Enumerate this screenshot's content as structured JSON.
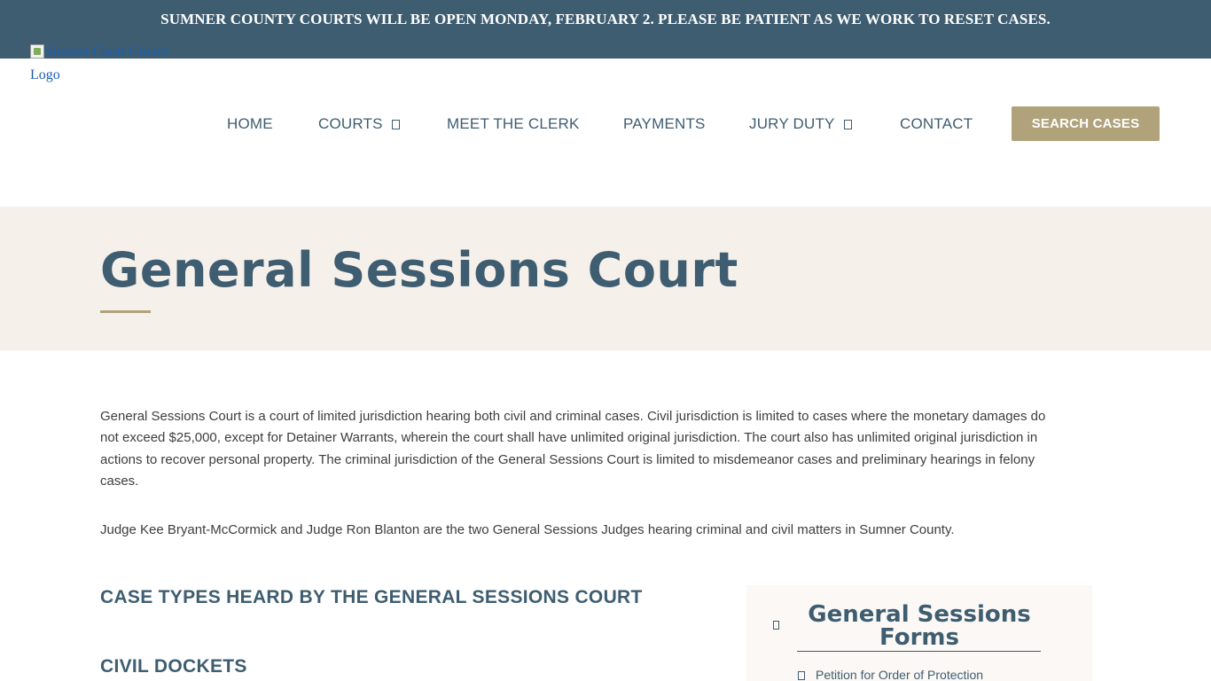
{
  "announcement": "SUMNER COUNTY COURTS WILL BE OPEN MONDAY, FEBRUARY 2. PLEASE BE PATIENT AS WE WORK TO RESET CASES.",
  "logo": {
    "alt_line1": "Sumner Court Circuit",
    "alt_line2": "Logo"
  },
  "nav": {
    "items": [
      {
        "label": "HOME",
        "has_dropdown": false
      },
      {
        "label": "COURTS",
        "has_dropdown": true
      },
      {
        "label": "MEET THE CLERK",
        "has_dropdown": false
      },
      {
        "label": "PAYMENTS",
        "has_dropdown": false
      },
      {
        "label": "JURY DUTY",
        "has_dropdown": true
      },
      {
        "label": "CONTACT",
        "has_dropdown": false
      }
    ],
    "cta_label": "SEARCH CASES"
  },
  "hero": {
    "title": "General Sessions Court"
  },
  "content": {
    "paragraph1": "General Sessions Court is a court of limited jurisdiction hearing both civil and criminal cases. Civil jurisdiction is limited to cases where the monetary damages do not exceed $25,000, except for Detainer Warrants, wherein the court shall have unlimited original jurisdiction. The court also has unlimited original jurisdiction in actions to recover personal property. The criminal jurisdiction of the General Sessions Court is limited to misdemeanor cases and preliminary hearings in felony cases.",
    "paragraph2": "Judge Kee Bryant-McCormick and Judge Ron Blanton are the two General Sessions Judges hearing criminal and civil matters in Sumner County.",
    "heading_case_types": "CASE TYPES HEARD BY THE GENERAL SESSIONS COURT",
    "heading_civil": "CIVIL DOCKETS"
  },
  "sidebar": {
    "title": "General Sessions Forms",
    "items": [
      "Petition for Order of Protection"
    ]
  },
  "colors": {
    "primary": "#3e5d70",
    "accent": "#b0a27a",
    "hero_bg": "#f6f0eb"
  },
  "icons": {
    "dropdown": "chevron-down-icon",
    "sidebar_toggle": "toggle-icon",
    "form_item": "document-icon"
  }
}
